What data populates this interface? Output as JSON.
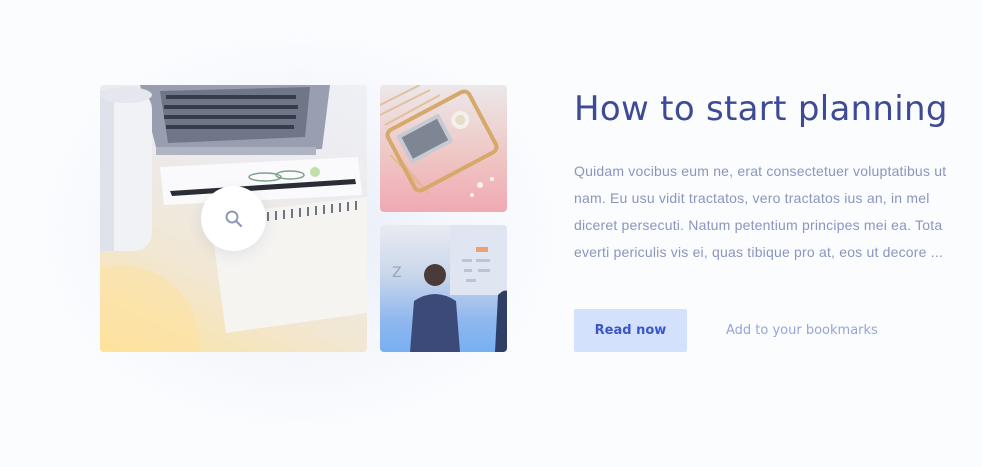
{
  "card": {
    "title": "How to start planning",
    "description": "Quidam vocibus eum ne, erat consectetuer voluptatibus ut nam. Eu usu vidit tractatos, vero tractatos ius an, in mel diceret persecuti. Natum petentium principes mei ea. Tota everti periculis vis ei, quas tibique pro at, eos ut decore ...",
    "read_button_label": "Read now",
    "bookmark_label": "Add to your bookmarks"
  },
  "gallery": {
    "images": [
      {
        "subject": "desk-laptop-notebook-photo"
      },
      {
        "subject": "laptop-on-tray-photo"
      },
      {
        "subject": "people-at-whiteboard-photo"
      }
    ],
    "zoom_icon": "search-icon"
  },
  "colors": {
    "title": "#3e4a96",
    "text": "#8b95bf",
    "button_bg": "#d3e1fd",
    "button_text": "#3b57c7",
    "link": "#97a5d6"
  }
}
